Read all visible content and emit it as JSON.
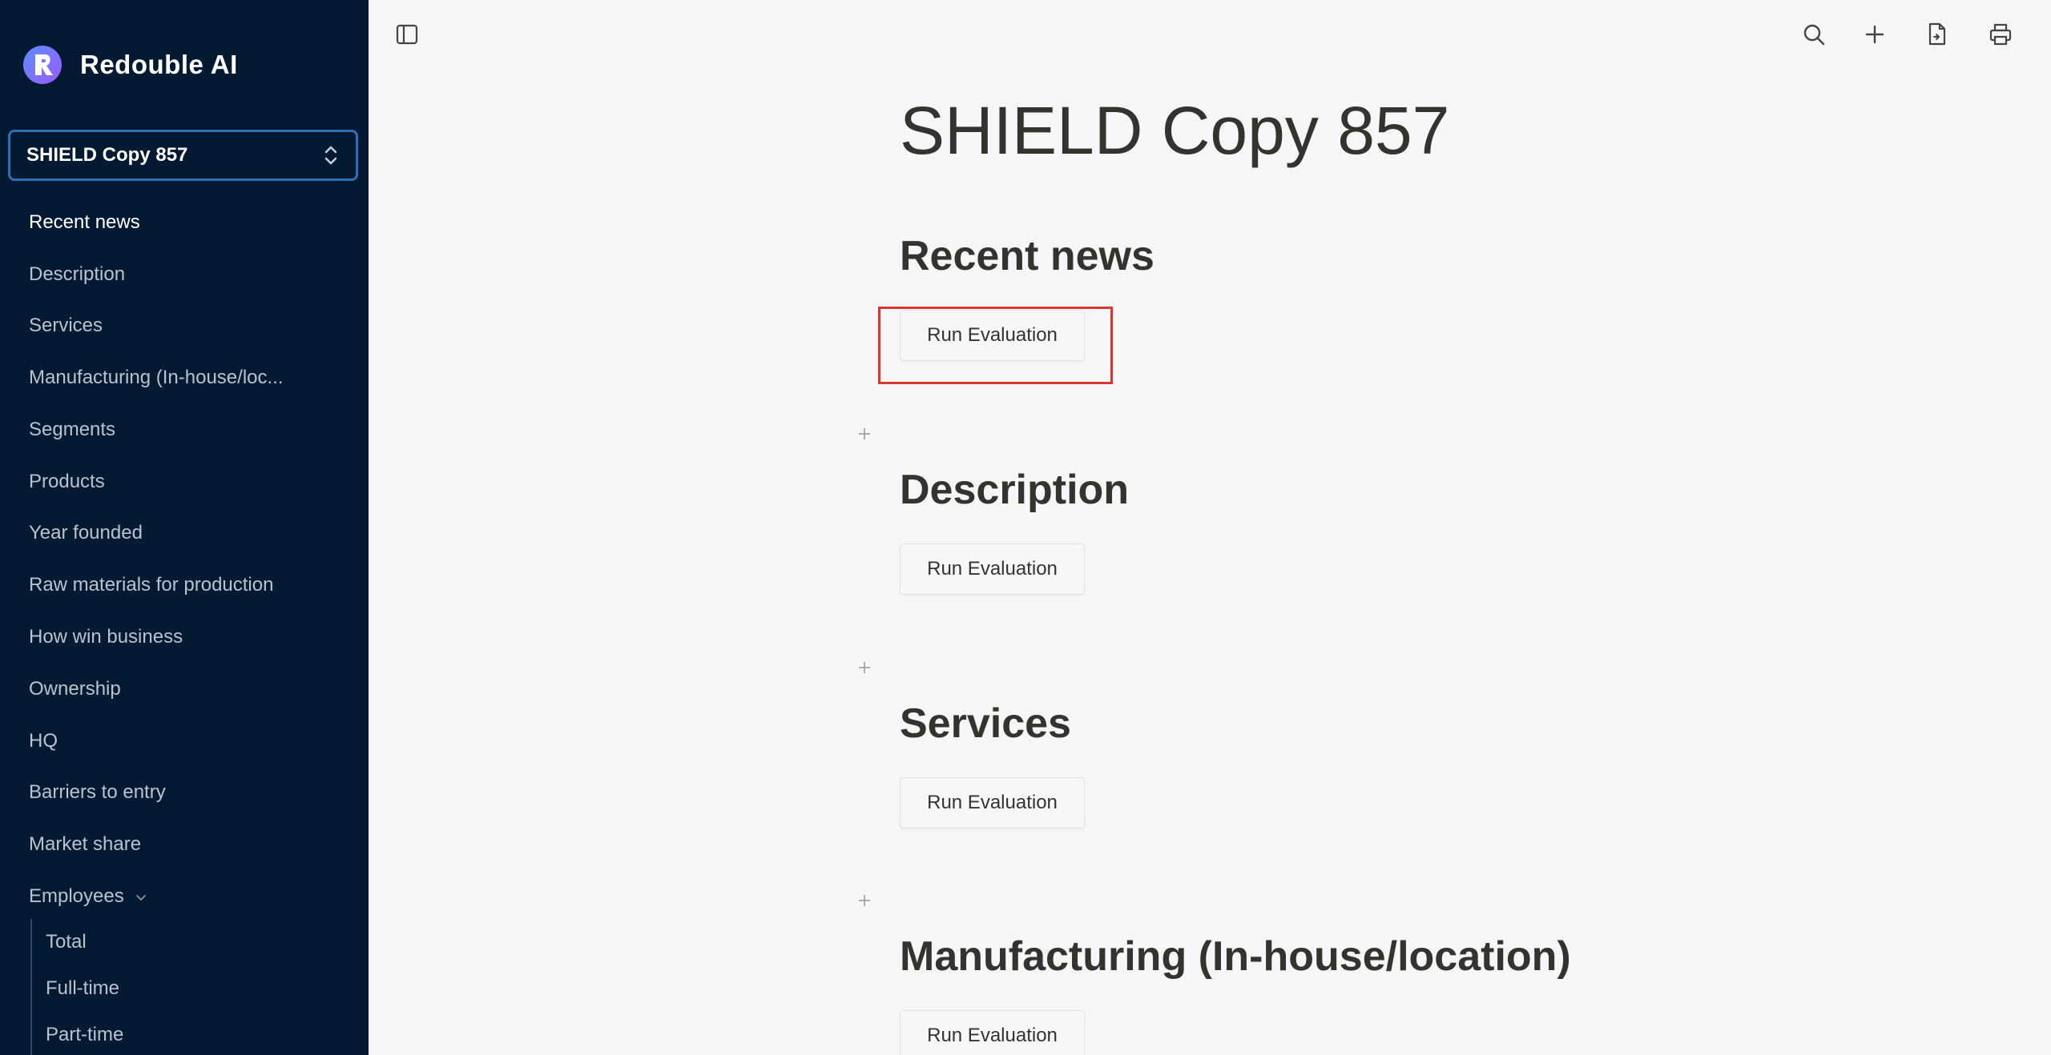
{
  "brand": {
    "name": "Redouble AI",
    "accent": "#7b5cff"
  },
  "document_selector": {
    "value": "SHIELD Copy 857"
  },
  "sidebar": {
    "items": [
      {
        "label": "Recent news",
        "active": true
      },
      {
        "label": "Description"
      },
      {
        "label": "Services"
      },
      {
        "label": "Manufacturing (In-house/loc..."
      },
      {
        "label": "Segments"
      },
      {
        "label": "Products"
      },
      {
        "label": "Year founded"
      },
      {
        "label": "Raw materials for production"
      },
      {
        "label": "How win business"
      },
      {
        "label": "Ownership"
      },
      {
        "label": "HQ"
      },
      {
        "label": "Barriers to entry"
      },
      {
        "label": "Market share"
      },
      {
        "label": "Employees",
        "expanded": true
      }
    ],
    "subitems": [
      {
        "label": "Total"
      },
      {
        "label": "Full-time"
      },
      {
        "label": "Part-time"
      }
    ]
  },
  "toolbar": {
    "icons": [
      "sidebar-toggle-icon",
      "search-icon",
      "plus-icon",
      "export-file-icon",
      "print-icon"
    ]
  },
  "main": {
    "title": "SHIELD Copy 857",
    "sections": [
      {
        "title": "Recent news",
        "button": "Run Evaluation"
      },
      {
        "title": "Description",
        "button": "Run Evaluation"
      },
      {
        "title": "Services",
        "button": "Run Evaluation"
      },
      {
        "title": "Manufacturing (In-house/location)",
        "button": "Run Evaluation"
      }
    ]
  },
  "colors": {
    "sidebar_bg": "#041a33",
    "select_border": "#2f6fb3",
    "highlight": "#d9372e",
    "main_bg": "#f6f6f6"
  }
}
